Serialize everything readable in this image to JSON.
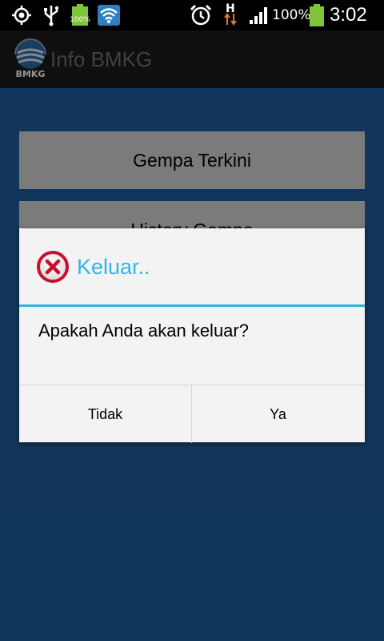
{
  "status_bar": {
    "battery_small_label": "100%",
    "battery_percent": "100%",
    "time": "3:02",
    "network_type": "H",
    "icons": [
      "gps-icon",
      "usb-icon",
      "battery-small-icon",
      "wifi-icon",
      "alarm-icon",
      "data-arrows-icon",
      "signal-icon",
      "battery-icon"
    ]
  },
  "action_bar": {
    "logo_text": "BMKG",
    "title": "Info BMKG"
  },
  "menu": {
    "items": [
      {
        "label": "Gempa Terkini"
      },
      {
        "label": "History Gempa"
      }
    ]
  },
  "dialog": {
    "title": "Keluar..",
    "message": "Apakah Anda akan keluar?",
    "negative_label": "Tidak",
    "positive_label": "Ya",
    "icon": "error-icon"
  },
  "colors": {
    "background": "#1f5e9e",
    "accent": "#33b5e5",
    "action_bar": "#1b1b1b"
  }
}
